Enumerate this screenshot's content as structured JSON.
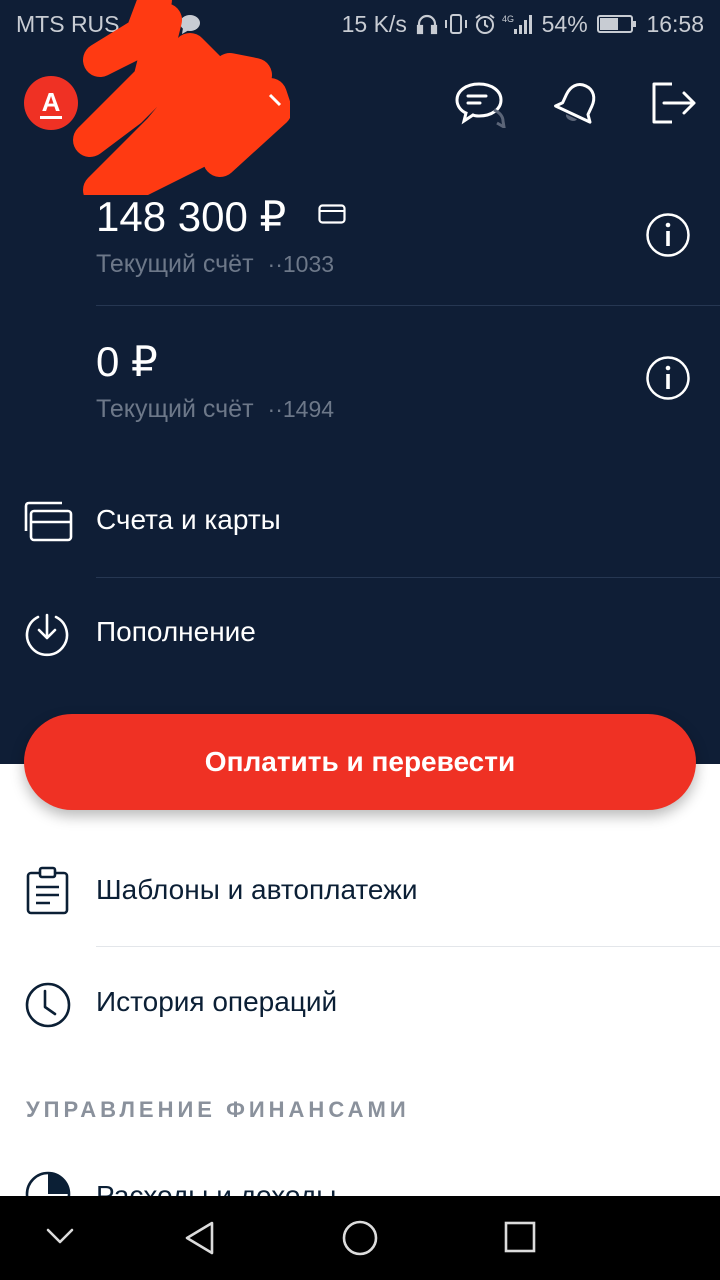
{
  "status_bar": {
    "carrier": "MTS RUS",
    "speed": "15 K/s",
    "battery": "54%",
    "time": "16:58",
    "net_type": "4G"
  },
  "header": {
    "logo_letter": "А",
    "icons": [
      "chat-icon",
      "bell-icon",
      "logout-icon"
    ]
  },
  "accounts": [
    {
      "amount": "148 300 ₽",
      "label": "Текущий счёт",
      "number": "··1033",
      "has_card": true
    },
    {
      "amount": "0 ₽",
      "label": "Текущий счёт",
      "number": "··1494",
      "has_card": false
    }
  ],
  "menu_dark": [
    {
      "label": "Счета и карты",
      "icon": "cards-icon"
    },
    {
      "label": "Пополнение",
      "icon": "download-circle-icon"
    }
  ],
  "cta": {
    "label": "Оплатить и перевести",
    "color": "#ef3124"
  },
  "menu_light": [
    {
      "label": "Шаблоны и автоплатежи",
      "icon": "clipboard-icon"
    },
    {
      "label": "История операций",
      "icon": "clock-icon"
    }
  ],
  "section_title": "УПРАВЛЕНИЕ ФИНАНСАМИ",
  "partial_item": {
    "label": "Расходы и доходы",
    "icon": "pie-chart-icon"
  },
  "colors": {
    "header_bg": "#0f1e36",
    "accent": "#ef3124",
    "text_dark": "#0b1f35"
  }
}
